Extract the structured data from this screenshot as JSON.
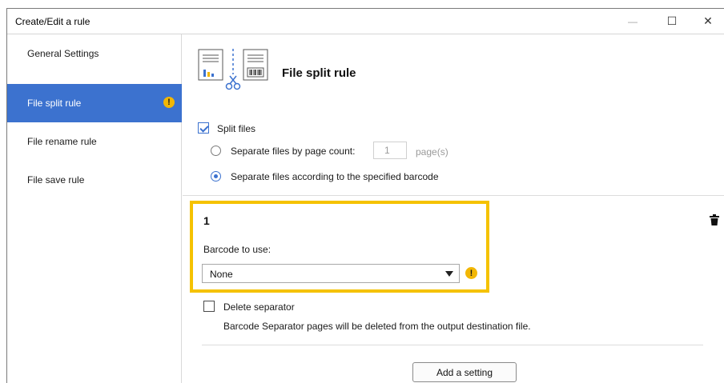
{
  "window": {
    "title": "Create/Edit a rule",
    "controls": {
      "minimize": "—",
      "maximize": "☐",
      "close": "✕"
    }
  },
  "sidebar": {
    "items": [
      {
        "label": "General Settings",
        "active": false,
        "warning": false
      },
      {
        "label": "File split rule",
        "active": true,
        "warning": true
      },
      {
        "label": "File rename rule",
        "active": false,
        "warning": false
      },
      {
        "label": "File save rule",
        "active": false,
        "warning": false
      }
    ],
    "warning_glyph": "!"
  },
  "main": {
    "header": {
      "title": "File split rule",
      "icon": "file-split-icon"
    },
    "split_files": {
      "label": "Split files",
      "checked": true
    },
    "by_page_count": {
      "label": "Separate files by page count:",
      "selected": false,
      "value": "1",
      "unit": "page(s)"
    },
    "by_barcode": {
      "label": "Separate files according to the specified barcode",
      "selected": true
    },
    "setting": {
      "number": "1",
      "barcode_label": "Barcode to use:",
      "barcode_value": "None",
      "warning_glyph": "!"
    },
    "delete_separator": {
      "label": "Delete separator",
      "checked": false,
      "description": "Barcode Separator pages will be deleted from the output destination file."
    },
    "add_button": "Add a setting"
  },
  "colors": {
    "accent": "#3c72cf",
    "highlight": "#f5c200",
    "warning": "#f2b705"
  }
}
